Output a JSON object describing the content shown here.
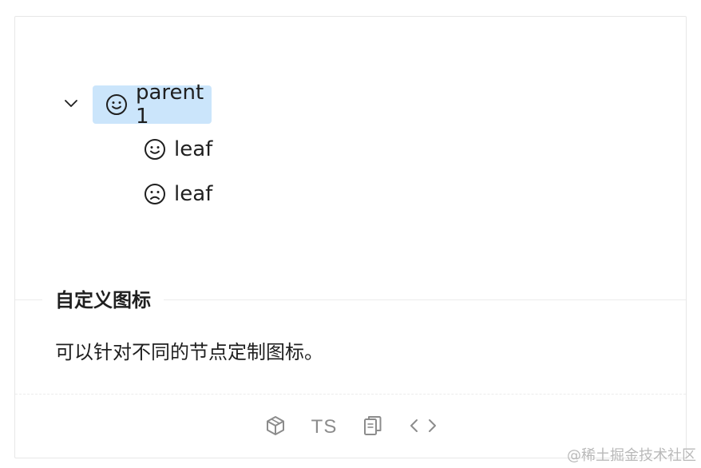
{
  "tree": {
    "switcher_icon": "chevron-down-icon",
    "nodes": [
      {
        "title": "parent 1",
        "icon": "smile-icon",
        "selected": true
      },
      {
        "title": "leaf",
        "icon": "smile-icon",
        "selected": false
      },
      {
        "title": "leaf",
        "icon": "frown-icon",
        "selected": false
      }
    ],
    "selected_color": "#cbe5fb"
  },
  "meta": {
    "title": "自定义图标",
    "description": "可以针对不同的节点定制图标。"
  },
  "actions": {
    "codesandbox_icon": "cube-icon",
    "ts_label": "TS",
    "copy_icon": "copy-icon",
    "code_icon": "code-icon"
  },
  "watermark": "@稀土掘金技术社区"
}
